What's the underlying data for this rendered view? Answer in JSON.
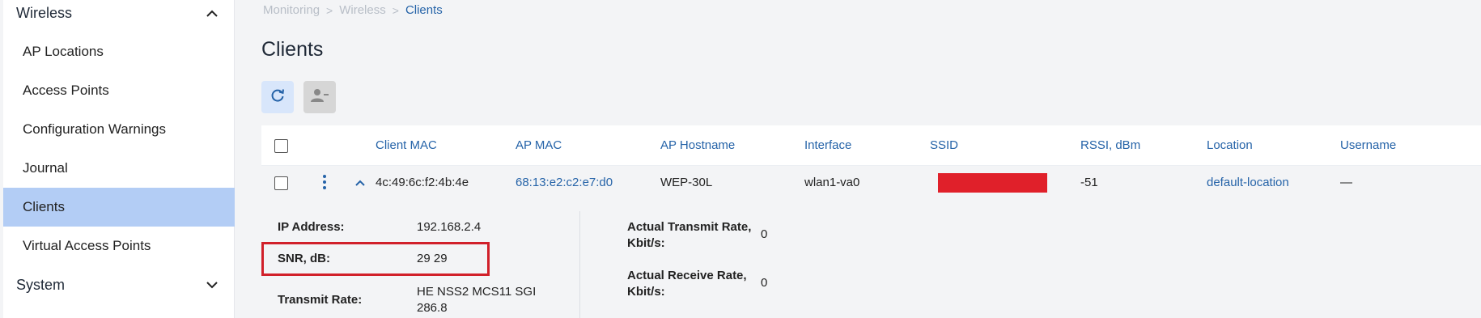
{
  "sidebar": {
    "wireless_label": "Wireless",
    "system_label": "System",
    "items": [
      {
        "label": "AP Locations"
      },
      {
        "label": "Access Points"
      },
      {
        "label": "Configuration Warnings"
      },
      {
        "label": "Journal"
      },
      {
        "label": "Clients"
      },
      {
        "label": "Virtual Access Points"
      }
    ]
  },
  "breadcrumb": {
    "items": [
      "Monitoring",
      "Wireless",
      "Clients"
    ],
    "separator": ">"
  },
  "page": {
    "title": "Clients"
  },
  "table": {
    "headers": {
      "client_mac": "Client MAC",
      "ap_mac": "AP MAC",
      "ap_hostname": "AP Hostname",
      "interface": "Interface",
      "ssid": "SSID",
      "rssi": "RSSI, dBm",
      "location": "Location",
      "username": "Username"
    },
    "row": {
      "client_mac": "4c:49:6c:f2:4b:4e",
      "ap_mac": "68:13:e2:c2:e7:d0",
      "ap_hostname": "WEP-30L",
      "interface": "wlan1-va0",
      "rssi": "-51",
      "location": "default-location",
      "username": "—"
    }
  },
  "details": {
    "ip_label": "IP Address:",
    "ip_value": "192.168.2.4",
    "snr_label": "SNR, dB:",
    "snr_value": "29 29",
    "tx_rate_label": "Transmit Rate:",
    "tx_rate_value_line1": "HE NSS2 MCS11 SGI",
    "tx_rate_value_line2": "286.8",
    "actual_tx_label_line1": "Actual Transmit Rate,",
    "actual_tx_label_line2": "Kbit/s:",
    "actual_tx_value": "0",
    "actual_rx_label_line1": "Actual Receive Rate,",
    "actual_rx_label_line2": "Kbit/s:",
    "actual_rx_value": "0"
  },
  "colors": {
    "accent": "#2563a8",
    "active_nav": "#b3cdf5",
    "redaction": "#e0202a",
    "highlight": "#d1202a"
  }
}
